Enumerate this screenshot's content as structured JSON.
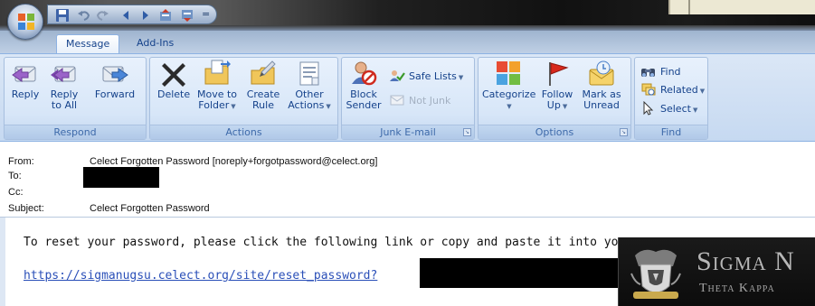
{
  "window": {
    "title_separator": "="
  },
  "tabs": [
    {
      "label": "Message",
      "active": true
    },
    {
      "label": "Add-Ins",
      "active": false
    }
  ],
  "ribbon": {
    "respond": {
      "label": "Respond",
      "reply": "Reply",
      "reply_all_1": "Reply",
      "reply_all_2": "to All",
      "forward": "Forward"
    },
    "actions": {
      "label": "Actions",
      "delete": "Delete",
      "move_1": "Move to",
      "move_2": "Folder",
      "create_1": "Create",
      "create_2": "Rule",
      "other_1": "Other",
      "other_2": "Actions"
    },
    "junk": {
      "label": "Junk E-mail",
      "block_1": "Block",
      "block_2": "Sender",
      "safe_lists": "Safe Lists",
      "not_junk": "Not Junk"
    },
    "options": {
      "label": "Options",
      "categorize": "Categorize",
      "follow_1": "Follow",
      "follow_2": "Up",
      "mark_1": "Mark as",
      "mark_2": "Unread"
    },
    "find": {
      "label": "Find",
      "find": "Find",
      "related": "Related",
      "select": "Select"
    }
  },
  "message": {
    "from_label": "From:",
    "from_value": "Celect Forgotten Password [noreply+forgotpassword@celect.org]",
    "to_label": "To:",
    "cc_label": "Cc:",
    "subject_label": "Subject:",
    "subject_value": "Celect Forgotten Password"
  },
  "body": {
    "line1": "To reset your password, please click the following link or copy and paste it into your",
    "link": "https://sigmanugsu.celect.org/site/reset_password?"
  },
  "banner": {
    "title": "Sigma N",
    "subtitle": "Theta Kappa"
  },
  "colors": {
    "ribbon_text": "#15428b",
    "ribbon_bg": "#c6d9f1",
    "link": "#2a4fb8"
  }
}
